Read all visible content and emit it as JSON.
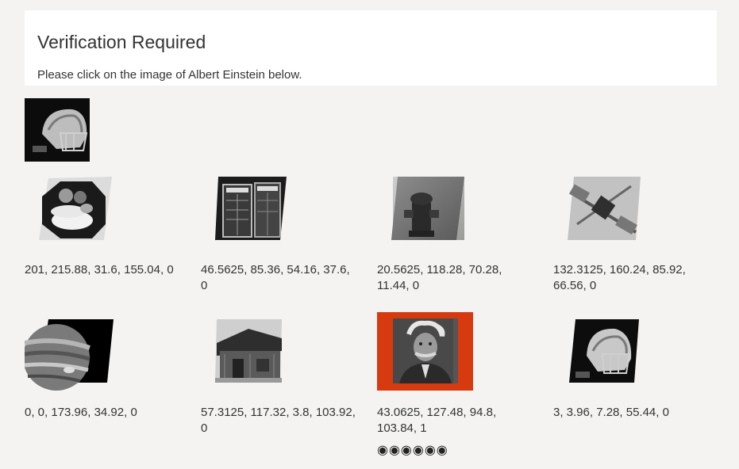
{
  "header": {
    "title": "Verification Required",
    "instruction": "Please click on the image of Albert Einstein below."
  },
  "reference_image": {
    "icon": "football-helmet-photo"
  },
  "choices": [
    {
      "subject": "fruit-plate-photo",
      "caption": "201, 215.88, 31.6, 155.04, 0",
      "selected": false
    },
    {
      "subject": "phone-booth-photo",
      "caption": "46.5625, 85.36, 54.16, 37.6, 0",
      "selected": false
    },
    {
      "subject": "fire-hydrant-photo",
      "caption": "20.5625, 118.28, 70.28, 11.44, 0",
      "selected": false
    },
    {
      "subject": "satellite-photo",
      "caption": "132.3125, 160.24, 85.92, 66.56, 0",
      "selected": false
    },
    {
      "subject": "jupiter-photo",
      "caption": "0, 0, 173.96, 34.92, 0",
      "selected": false
    },
    {
      "subject": "barn-photo",
      "caption": "57.3125, 117.32, 3.8, 103.92, 0",
      "selected": false
    },
    {
      "subject": "einstein-photo",
      "caption": "43.0625, 127.48, 94.8, 103.84, 1",
      "selected": true,
      "rating": "◉◉◉◉◉◉"
    },
    {
      "subject": "football-helmet-photo",
      "caption": "3, 3.96, 7.28, 55.44, 0",
      "selected": false
    }
  ],
  "colors": {
    "background": "#f4f3f1",
    "card": "#ffffff",
    "selected_border": "#d83a10",
    "text": "#333333"
  }
}
